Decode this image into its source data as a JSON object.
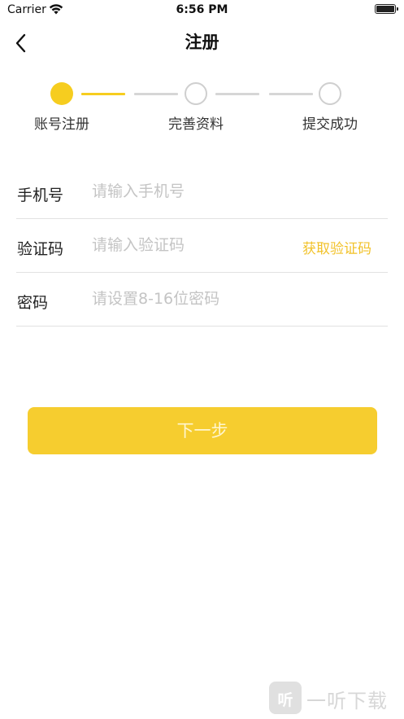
{
  "status_bar": {
    "carrier": "Carrier",
    "time": "6:56 PM",
    "wifi_icon": "wifi-icon",
    "battery_icon": "battery-icon"
  },
  "nav": {
    "title": "注册",
    "back_icon": "chevron-left-icon"
  },
  "steps": [
    {
      "label": "账号注册",
      "state": "active"
    },
    {
      "label": "完善资料",
      "state": "inactive"
    },
    {
      "label": "提交成功",
      "state": "inactive"
    }
  ],
  "form": {
    "phone": {
      "label": "手机号",
      "value": "",
      "placeholder": "请输入手机号"
    },
    "code": {
      "label": "验证码",
      "value": "",
      "placeholder": "请输入验证码",
      "action_label": "获取验证码"
    },
    "password": {
      "label": "密码",
      "value": "",
      "placeholder": "请设置8-16位密码"
    }
  },
  "next_button": {
    "label": "下一步"
  },
  "watermark": {
    "logo_text": "听",
    "text": "一听下载"
  },
  "colors": {
    "accent": "#f6cd2f",
    "accent_text": "#f2c22a",
    "divider": "#e2e2e2",
    "placeholder": "#c4c4c4",
    "inactive_step": "#d6d6d6"
  }
}
